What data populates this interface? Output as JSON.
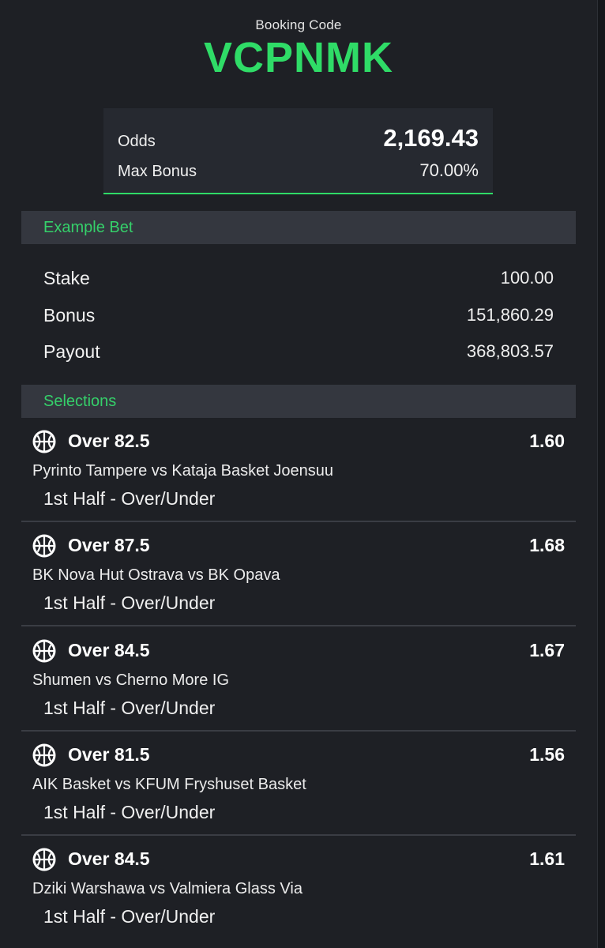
{
  "booking": {
    "label": "Booking Code",
    "code": "VCPNMK"
  },
  "summary": {
    "odds_label": "Odds",
    "odds_value": "2,169.43",
    "bonus_label": "Max Bonus",
    "bonus_value": "70.00%"
  },
  "example": {
    "heading": "Example Bet",
    "rows": [
      {
        "label": "Stake",
        "value": "100.00"
      },
      {
        "label": "Bonus",
        "value": "151,860.29"
      },
      {
        "label": "Payout",
        "value": "368,803.57"
      }
    ]
  },
  "selections": {
    "heading": "Selections",
    "items": [
      {
        "pick": "Over 82.5",
        "odds": "1.60",
        "match": "Pyrinto Tampere vs Kataja Basket Joensuu",
        "market": "1st Half - Over/Under",
        "icon": "basketball-icon"
      },
      {
        "pick": "Over 87.5",
        "odds": "1.68",
        "match": "BK Nova Hut Ostrava vs BK Opava",
        "market": "1st Half - Over/Under",
        "icon": "basketball-icon"
      },
      {
        "pick": "Over 84.5",
        "odds": "1.67",
        "match": "Shumen vs Cherno More IG",
        "market": "1st Half - Over/Under",
        "icon": "basketball-icon"
      },
      {
        "pick": "Over 81.5",
        "odds": "1.56",
        "match": "AIK Basket vs KFUM Fryshuset Basket",
        "market": "1st Half - Over/Under",
        "icon": "basketball-icon"
      },
      {
        "pick": "Over 84.5",
        "odds": "1.61",
        "match": "Dziki Warshawa vs Valmiera Glass Via",
        "market": "1st Half - Over/Under",
        "icon": "basketball-icon"
      }
    ]
  },
  "colors": {
    "accent": "#2fdc67",
    "background": "#1e2025",
    "panel": "#262930",
    "section_header": "#34373f"
  }
}
